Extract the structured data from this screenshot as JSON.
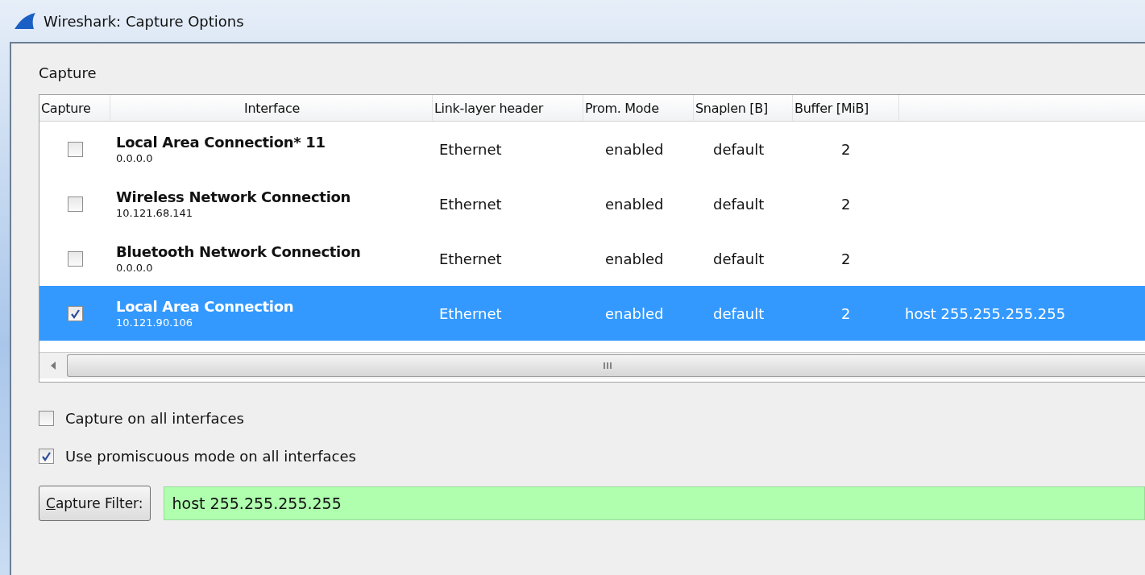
{
  "window": {
    "title": "Wireshark: Capture Options"
  },
  "group_label": "Capture",
  "table": {
    "columns": [
      "Capture",
      "Interface",
      "Link-layer header",
      "Prom. Mode",
      "Snaplen [B]",
      "Buffer [MiB]"
    ],
    "rows": [
      {
        "checked": false,
        "selected": false,
        "name": "Local Area Connection* 11",
        "address": "0.0.0.0",
        "link_layer": "Ethernet",
        "prom_mode": "enabled",
        "snaplen": "default",
        "buffer": "2"
      },
      {
        "checked": false,
        "selected": false,
        "name": "Wireless Network Connection",
        "address": "10.121.68.141",
        "link_layer": "Ethernet",
        "prom_mode": "enabled",
        "snaplen": "default",
        "buffer": "2"
      },
      {
        "checked": false,
        "selected": false,
        "name": "Bluetooth Network Connection",
        "address": "0.0.0.0",
        "link_layer": "Ethernet",
        "prom_mode": "enabled",
        "snaplen": "default",
        "buffer": "2"
      },
      {
        "checked": true,
        "selected": true,
        "name": "Local Area Connection",
        "address": "10.121.90.106",
        "link_layer": "Ethernet",
        "prom_mode": "enabled",
        "snaplen": "default",
        "buffer": "2",
        "column_7": "host 255.255.255.255"
      }
    ]
  },
  "options": [
    {
      "label": "Capture on all interfaces",
      "checked": false
    },
    {
      "label": "Use promiscuous mode on all interfaces",
      "checked": true
    }
  ],
  "capture_filter": {
    "button": "Capture Filter:",
    "value": "host 255.255.255.255"
  }
}
